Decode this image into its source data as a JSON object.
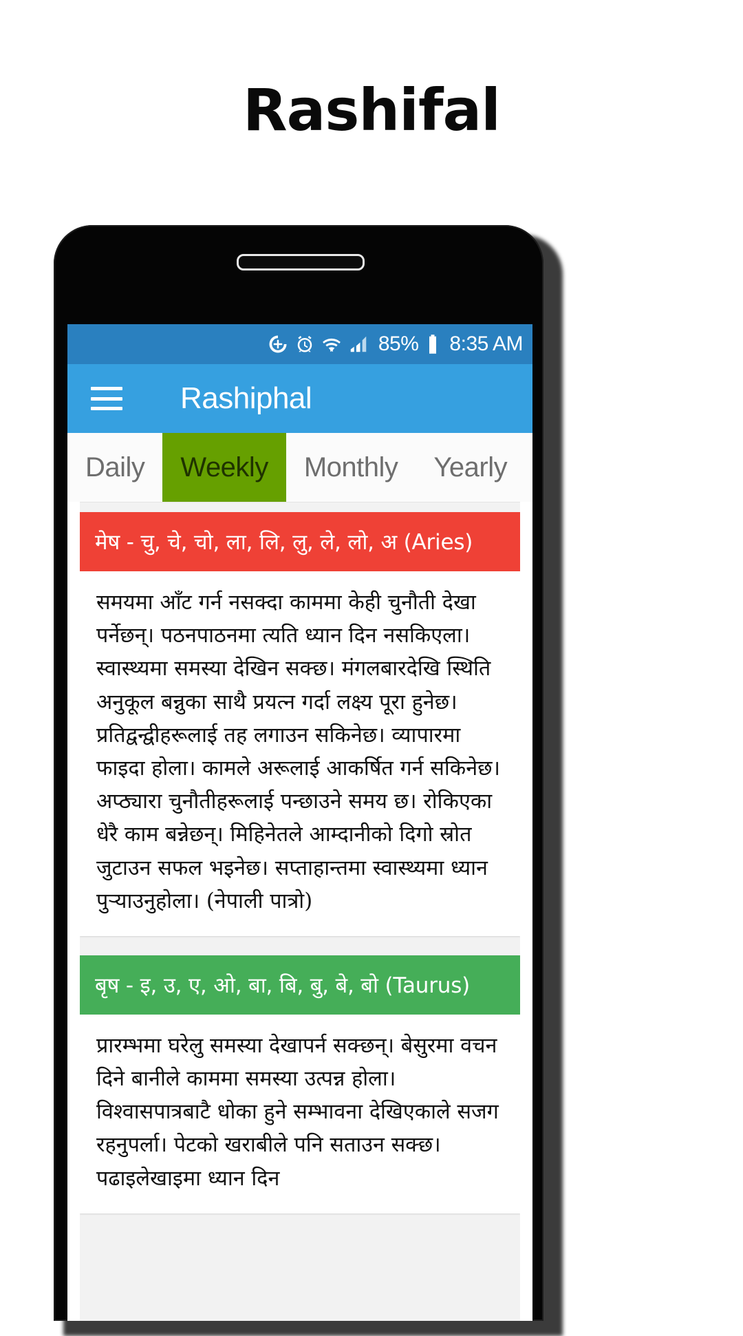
{
  "page": {
    "title": "Rashifal"
  },
  "status_bar": {
    "icons": [
      "add-circle-icon",
      "alarm-icon",
      "wifi-icon",
      "signal-icon"
    ],
    "battery_percent": "85%",
    "battery_icon": "battery-icon",
    "time": "8:35 AM"
  },
  "app_bar": {
    "menu_icon": "hamburger-menu-icon",
    "title": "Rashiphal",
    "background_color": "#36a0e0"
  },
  "tabs": {
    "items": [
      {
        "label": "Daily",
        "active": false
      },
      {
        "label": "Weekly",
        "active": true
      },
      {
        "label": "Monthly",
        "active": false
      },
      {
        "label": "Yearly",
        "active": false
      }
    ],
    "active_color": "#66a000"
  },
  "signs": [
    {
      "header": "मेष - चु, चे, चो, ला, लि, लु, ले, लो, अ (Aries)",
      "header_color": "#ef4136",
      "body": "समयमा आँट गर्न नसक्दा काममा केही चुनौती देखा पर्नेछन्। पठनपाठनमा त्यति ध्यान दिन नसकिएला। स्वास्थ्यमा समस्या देखिन सक्छ। मंगलबारदेखि स्थिति अनुकूल बन्नुका साथै प्रयत्न गर्दा लक्ष्य पूरा हुनेछ। प्रतिद्वन्द्वीहरूलाई तह लगाउन सकिनेछ। व्यापारमा फाइदा होला। कामले अरूलाई आकर्षित गर्न सकिनेछ। अप्ठ्यारा चुनौतीहरूलाई पन्छाउने समय छ। रोकिएका धेरै काम बन्नेछन्। मिहिनेतले आम्दानीको दिगो स्रोत जुटाउन सफल भइनेछ। सप्ताहान्तमा स्वास्थ्यमा ध्यान पुर्‍याउनुहोला। (नेपाली पात्रो)"
    },
    {
      "header": "बृष - इ, उ, ए, ओ, बा, बि, बु, बे, बो (Taurus)",
      "header_color": "#45ae58",
      "body": "प्रारम्भमा घरेलु समस्या देखापर्न सक्छन्। बेसुरमा वचन दिने बानीले काममा समस्या उत्पन्न होला। विश्वासपात्रबाटै धोका हुने सम्भावना देखिएकाले सजग रहनुपर्ला। पेटको खराबीले पनि सताउन सक्छ। पढाइलेखाइमा ध्यान दिन"
    }
  ]
}
